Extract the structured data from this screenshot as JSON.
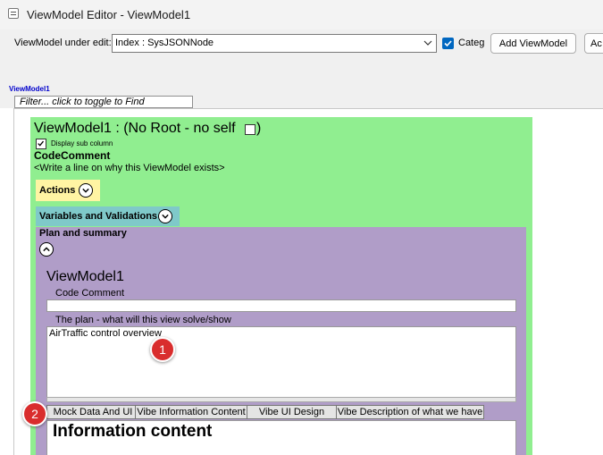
{
  "window": {
    "title": "ViewModel Editor - ViewModel1"
  },
  "toolbar": {
    "vm_label": "ViewModel under edit:",
    "vm_select_value": "Index : SysJSONNode",
    "categ_label": "Categ",
    "categ_checked": true,
    "add_button": "Add ViewModel",
    "act_button": "Ac",
    "vm_link": "ViewModel1",
    "filter_placeholder": "Filter... click to toggle to Find"
  },
  "editor": {
    "heading": "ViewModel1 :   (No Root - no self",
    "heading_close": ")",
    "display_sub_label": "Display sub column",
    "display_sub_checked": true,
    "codecomment_label": "CodeComment",
    "codecomment_text": "<Write a line on why this ViewModel exists>",
    "actions_label": "Actions",
    "vars_label": "Variables and Validations",
    "plan": {
      "label": "Plan and summary",
      "vm_title": "ViewModel1",
      "code_comment_label": "Code Comment",
      "code_comment_value": "",
      "purpose_label": "The plan - what will this view solve/show",
      "purpose_value": "AirTraffic control overview"
    },
    "tabs": [
      {
        "label": "Mock Data And UI"
      },
      {
        "label": "Vibe Information Content"
      },
      {
        "label": "Vibe UI Design"
      },
      {
        "label": "Vibe Description of what we have"
      }
    ],
    "info_heading": "Information content"
  },
  "markers": [
    "1",
    "2"
  ],
  "colors": {
    "green_panel": "#90ee90",
    "actions_bg": "#fff4a3",
    "vars_bg": "#7fc9c9",
    "plan_bg": "#b09dc8",
    "marker": "#d92d2d",
    "accent": "#0067c0"
  },
  "icons": {
    "app": "window-icon",
    "dropdown": "chevron-down-icon",
    "collapse": "chevron-up-icon",
    "expand": "chevron-down-icon",
    "check": "checkmark-icon"
  }
}
